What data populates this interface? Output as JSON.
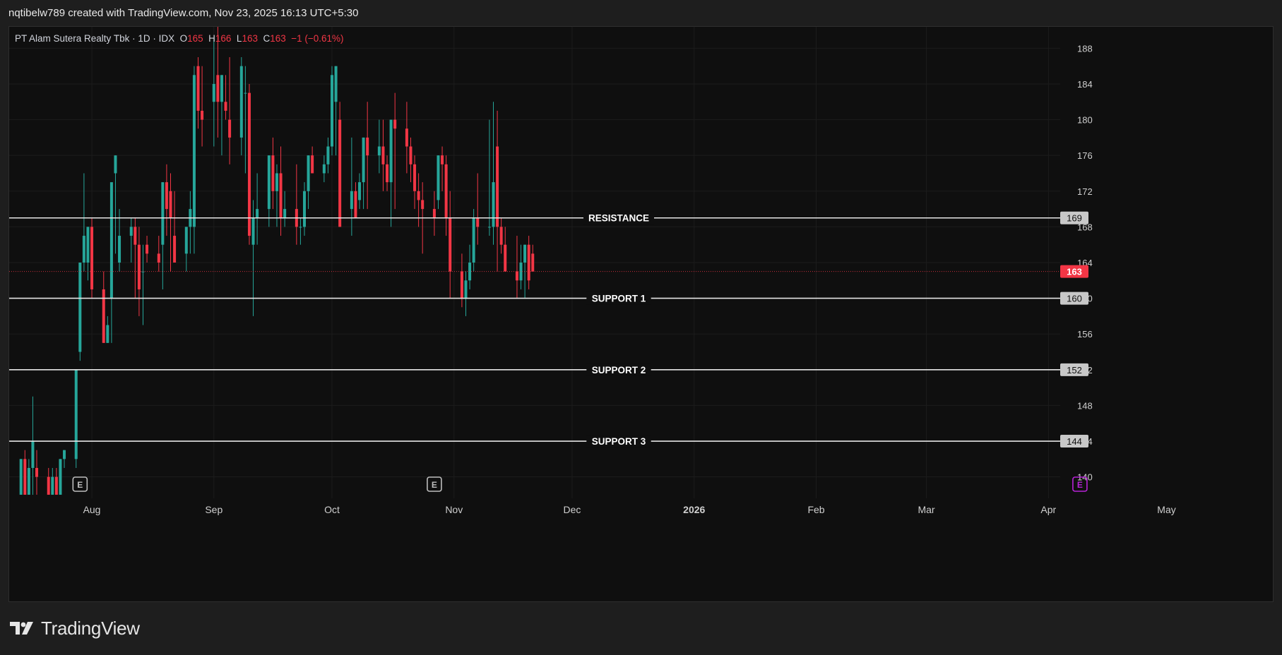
{
  "header": {
    "attribution": "nqtibelw789 created with TradingView.com, Nov 23, 2025 16:13 UTC+5:30"
  },
  "footer": {
    "brand": "TradingView"
  },
  "colors": {
    "up": "#26a69a",
    "down": "#f23645",
    "background": "#0f0f0f",
    "grid": "#1c1c1c",
    "text": "#d1d4dc",
    "level_line": "#e6e6e6",
    "price_tag": "#f23645",
    "earnings_future": "#b622d6"
  },
  "chart_data": {
    "type": "candlestick",
    "symbol": "PT Alam Sutera Realty Tbk · 1D · IDX",
    "ohlc_summary": {
      "O": "165",
      "H": "166",
      "L": "163",
      "C": "163",
      "change": "−1 (−0.61%)"
    },
    "y_axis": {
      "ticks": [
        140,
        144,
        148,
        152,
        156,
        160,
        164,
        168,
        172,
        176,
        180,
        184,
        188
      ],
      "range": [
        137.6,
        190.4
      ]
    },
    "x_axis": {
      "labels": [
        {
          "date": "2025-08-01",
          "label": "Aug"
        },
        {
          "date": "2025-09-01",
          "label": "Sep"
        },
        {
          "date": "2025-10-01",
          "label": "Oct"
        },
        {
          "date": "2025-11-01",
          "label": "Nov"
        },
        {
          "date": "2025-12-01",
          "label": "Dec"
        },
        {
          "date": "2026-01-01",
          "label": "2026"
        },
        {
          "date": "2026-02-01",
          "label": "Feb"
        },
        {
          "date": "2026-03-01",
          "label": "Mar"
        },
        {
          "date": "2026-04-01",
          "label": "Apr"
        },
        {
          "date": "2026-05-01",
          "label": "May"
        }
      ],
      "range": [
        "2025-07-11",
        "2026-05-28"
      ]
    },
    "last_price": "163",
    "levels": [
      {
        "label": "RESISTANCE",
        "price": 169,
        "tag": "169"
      },
      {
        "label": "SUPPORT 1",
        "price": 160,
        "tag": "160"
      },
      {
        "label": "SUPPORT 2",
        "price": 152,
        "tag": "152"
      },
      {
        "label": "SUPPORT 3",
        "price": 144,
        "tag": "144"
      }
    ],
    "earnings_markers": [
      {
        "date": "2025-07-29",
        "label": "E",
        "future": false
      },
      {
        "date": "2025-10-27",
        "label": "E",
        "future": false
      },
      {
        "date": "2026-04-09",
        "label": "E",
        "future": true
      }
    ],
    "candles": [
      [
        "2025-07-14",
        138,
        142,
        138,
        142
      ],
      [
        "2025-07-15",
        142,
        143,
        138,
        138
      ],
      [
        "2025-07-16",
        138,
        142,
        138,
        141
      ],
      [
        "2025-07-17",
        141,
        149,
        138,
        144
      ],
      [
        "2025-07-18",
        141,
        143,
        138,
        140
      ],
      [
        "2025-07-21",
        140,
        141,
        138,
        138
      ],
      [
        "2025-07-22",
        138,
        141,
        138,
        140
      ],
      [
        "2025-07-23",
        140,
        141,
        138,
        138
      ],
      [
        "2025-07-24",
        138,
        142,
        138,
        142
      ],
      [
        "2025-07-25",
        142,
        143,
        141,
        143
      ],
      [
        "2025-07-28",
        142,
        152,
        141,
        152
      ],
      [
        "2025-07-29",
        154,
        164,
        153,
        164
      ],
      [
        "2025-07-30",
        164,
        174,
        163,
        167
      ],
      [
        "2025-07-31",
        164,
        168,
        162,
        168
      ],
      [
        "2025-08-01",
        168,
        169,
        160,
        161
      ],
      [
        "2025-08-04",
        161,
        163,
        155,
        155
      ],
      [
        "2025-08-05",
        155,
        158,
        155,
        157
      ],
      [
        "2025-08-06",
        160,
        170,
        155,
        173
      ],
      [
        "2025-08-07",
        174,
        176,
        165,
        176
      ],
      [
        "2025-08-08",
        164,
        170,
        163,
        167
      ],
      [
        "2025-08-11",
        167,
        169,
        164,
        168
      ],
      [
        "2025-08-12",
        168,
        169,
        160,
        166
      ],
      [
        "2025-08-13",
        166,
        168,
        158,
        161
      ],
      [
        "2025-08-14",
        163,
        166,
        157,
        163
      ],
      [
        "2025-08-15",
        166,
        167,
        164,
        165
      ],
      [
        "2025-08-18",
        165,
        167,
        163,
        164
      ],
      [
        "2025-08-19",
        166,
        173,
        161,
        173
      ],
      [
        "2025-08-20",
        173,
        175,
        167,
        170
      ],
      [
        "2025-08-21",
        172,
        174,
        163,
        169
      ],
      [
        "2025-08-22",
        167,
        172,
        164,
        164
      ],
      [
        "2025-08-25",
        165,
        168,
        163,
        168
      ],
      [
        "2025-08-26",
        168,
        172,
        165,
        170
      ],
      [
        "2025-08-27",
        168,
        186,
        165,
        185
      ],
      [
        "2025-08-28",
        186,
        187,
        179,
        181
      ],
      [
        "2025-08-29",
        181,
        186,
        177,
        180
      ],
      [
        "2025-09-01",
        182,
        189,
        177,
        184
      ],
      [
        "2025-09-02",
        185,
        191,
        178,
        182
      ],
      [
        "2025-09-03",
        182,
        185,
        176,
        185
      ],
      [
        "2025-09-04",
        182,
        185,
        180,
        181
      ],
      [
        "2025-09-05",
        180,
        187,
        175,
        178
      ],
      [
        "2025-09-08",
        178,
        187,
        176,
        186
      ],
      [
        "2025-09-09",
        183,
        186,
        174,
        183
      ],
      [
        "2025-09-10",
        183,
        184,
        166,
        167
      ],
      [
        "2025-09-11",
        166,
        171,
        158,
        169
      ],
      [
        "2025-09-12",
        169,
        174,
        166,
        170
      ],
      [
        "2025-09-15",
        170,
        176,
        168,
        176
      ],
      [
        "2025-09-16",
        176,
        178,
        170,
        172
      ],
      [
        "2025-09-17",
        172,
        175,
        168,
        174
      ],
      [
        "2025-09-18",
        174,
        177,
        167,
        169
      ],
      [
        "2025-09-19",
        169,
        172,
        168,
        170
      ],
      [
        "2025-09-22",
        170,
        175,
        166,
        168
      ],
      [
        "2025-09-23",
        168,
        169,
        166,
        168
      ],
      [
        "2025-09-24",
        168,
        173,
        167,
        172
      ],
      [
        "2025-09-25",
        172,
        176,
        170,
        176
      ],
      [
        "2025-09-26",
        176,
        177,
        174,
        174
      ],
      [
        "2025-09-29",
        174,
        176,
        173,
        175
      ],
      [
        "2025-09-30",
        175,
        178,
        174,
        177
      ],
      [
        "2025-10-01",
        177,
        186,
        176,
        185
      ],
      [
        "2025-10-02",
        182,
        186,
        176,
        186
      ],
      [
        "2025-10-03",
        180,
        182,
        168,
        168
      ],
      [
        "2025-10-06",
        170,
        178,
        167,
        172
      ],
      [
        "2025-10-07",
        172,
        173,
        169,
        169
      ],
      [
        "2025-10-08",
        171,
        174,
        170,
        173
      ],
      [
        "2025-10-09",
        173,
        178,
        170,
        178
      ],
      [
        "2025-10-10",
        178,
        182,
        170,
        176
      ],
      [
        "2025-10-13",
        176,
        180,
        174,
        177
      ],
      [
        "2025-10-14",
        177,
        180,
        172,
        175
      ],
      [
        "2025-10-15",
        175,
        176,
        172,
        173
      ],
      [
        "2025-10-16",
        173,
        179,
        168,
        180
      ],
      [
        "2025-10-17",
        180,
        183,
        170,
        179
      ],
      [
        "2025-10-20",
        179,
        182,
        174,
        177
      ],
      [
        "2025-10-21",
        177,
        178,
        173,
        175
      ],
      [
        "2025-10-22",
        175,
        176,
        170,
        172
      ],
      [
        "2025-10-23",
        172,
        174,
        168,
        171
      ],
      [
        "2025-10-24",
        171,
        173,
        165,
        170
      ],
      [
        "2025-10-27",
        170,
        172,
        167,
        169
      ],
      [
        "2025-10-28",
        171,
        176,
        170,
        176
      ],
      [
        "2025-10-29",
        176,
        177,
        172,
        175
      ],
      [
        "2025-10-30",
        175,
        176,
        167,
        169
      ],
      [
        "2025-10-31",
        169,
        172,
        160,
        163
      ],
      [
        "2025-11-03",
        163,
        165,
        159,
        160
      ],
      [
        "2025-11-04",
        160,
        163,
        158,
        162
      ],
      [
        "2025-11-05",
        162,
        166,
        161,
        164
      ],
      [
        "2025-11-06",
        164,
        170,
        163,
        169
      ],
      [
        "2025-11-07",
        169,
        174,
        166,
        168
      ],
      [
        "2025-11-10",
        168,
        180,
        167,
        168
      ],
      [
        "2025-11-11",
        168,
        182,
        166,
        173
      ],
      [
        "2025-11-12",
        177,
        181,
        163,
        168
      ],
      [
        "2025-11-13",
        168,
        169,
        165,
        166
      ],
      [
        "2025-11-14",
        166,
        168,
        163,
        163
      ],
      [
        "2025-11-17",
        163,
        167,
        160,
        162
      ],
      [
        "2025-11-18",
        162,
        166,
        161,
        164
      ],
      [
        "2025-11-19",
        164,
        166,
        160,
        166
      ],
      [
        "2025-11-20",
        166,
        167,
        161,
        162
      ],
      [
        "2025-11-21",
        165,
        166,
        163,
        163
      ]
    ]
  }
}
